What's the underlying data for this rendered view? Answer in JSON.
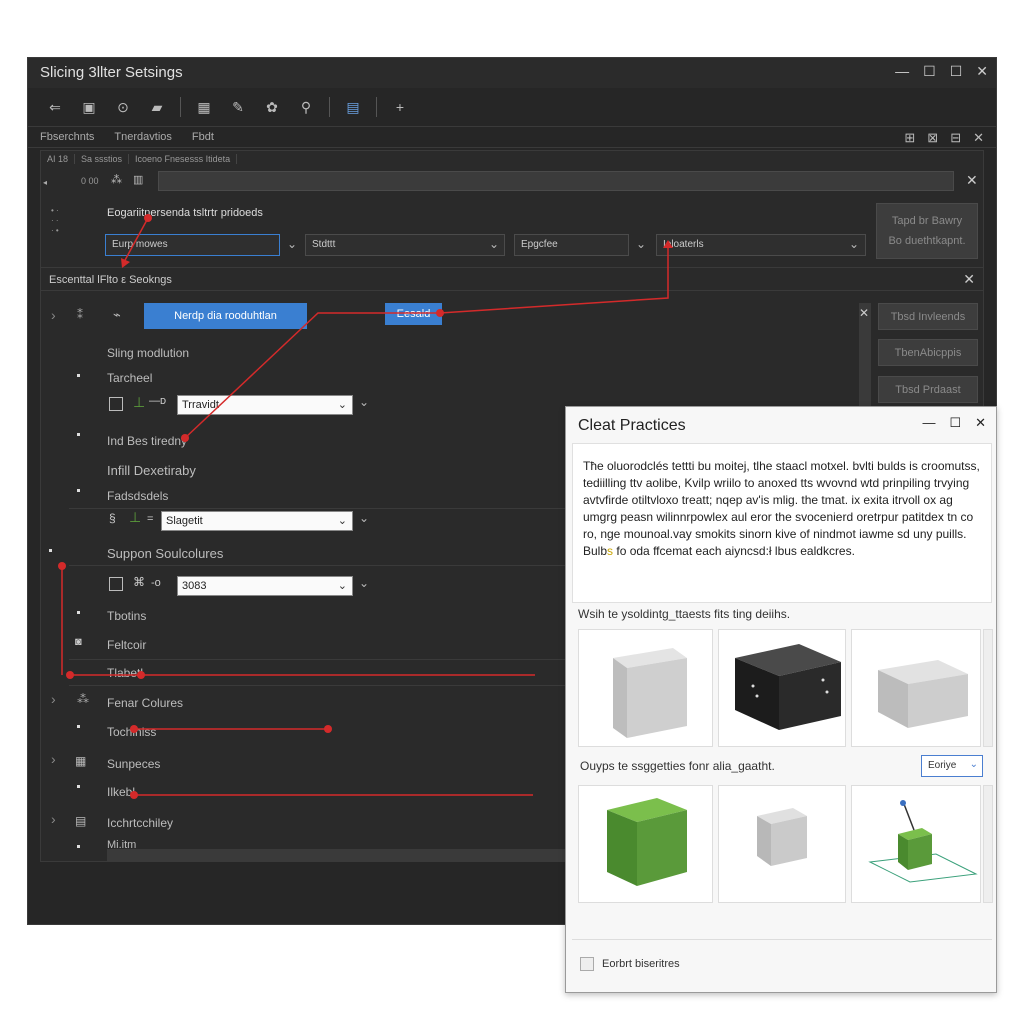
{
  "window": {
    "title": "Slicing 3llter  Setsings",
    "controls": [
      "—",
      "☐",
      "☐",
      "✕"
    ]
  },
  "tabs": {
    "items": [
      "Fbserchnts",
      "Tnerdavtios",
      "Fbdt"
    ]
  },
  "subtabs": [
    "AI  18",
    "Sa  ssstios",
    "Icoeno Fnesesss Itideta"
  ],
  "left_marks": {
    "m1": "0 00"
  },
  "profile": {
    "label": "Eogariitnersenda tsltrtr pridoeds",
    "dropdown1": "Eurp mowes",
    "dropdown2": "Stdttt",
    "dropdown3": "Epgcfee",
    "dropdown4": "Ieloaterls",
    "right_button_line1": "Tapd br Bawry",
    "right_button_line2": "Bo duethtkapnt."
  },
  "section": {
    "title": "Escenttal lFlto ε Seokngs"
  },
  "actions": {
    "blue_button": "Nerdp dia rooduhtlan",
    "second_button": "Eesald"
  },
  "right_buttons": [
    "Tbsd Invleends",
    "TbenAbicppis",
    "Tbsd Prdaast"
  ],
  "rows": {
    "r1": "Sling modlution",
    "r2": "Tarcheel",
    "r3": "Ind Bes tiredny",
    "r4": "Infill Dexetiraby",
    "r5": "Fadsdsdels",
    "r6": "Suppon Soulcolures",
    "r7": "Tbotins",
    "r8": "Feltcoir",
    "r9": "Tlabetl",
    "r10": "Fenar Colures",
    "r11": "Tochiniss",
    "r12": "Sunpeces",
    "r13": "Ilkebl",
    "r14": "Icchrtcchiley",
    "r15": "Mi.itm"
  },
  "selects": {
    "s1": "Trravidt",
    "s2": "Slagetit",
    "s3": "3083"
  },
  "dialog": {
    "title": "Cleat Practices",
    "controls": [
      "—",
      "☐",
      "✕"
    ],
    "text_before": "Tħe oluorodclés tettti bu moitej,  tlhe staacl motxel. bvlti bulds is croomutss, tediilling ttv aolibe, Kvilp wriilo to anoxed tts wvovnd wtd prinpiling trvying avtvfirde otiltvloxo treatt; nqep av'is mlig. the tmat. ix exita itrvoll ox ag umgrg peasn wilinnrpowlex aul eror the svocenierd oretrpur patitdex tn co ro, nge mounoal.vay smokits sinorn kive of nindmot iawme sd uny puills. Bulb",
    "text_highlight": "s",
    "text_after": " fo oda ffcemat each aiyncsd:ł lbus ealdkcres.",
    "label1": "Wsih te ysoldintg_ttaests fits ting deiihs.",
    "label2": "Ouyps te ssggetties  fonr alia_gaatht.",
    "select": "Eoriye",
    "footer_button": "Eorbrt biseritres"
  },
  "colors": {
    "accent": "#3a7fd1",
    "annotation": "#d42a2a",
    "cube_green": "#5a9a3a"
  }
}
